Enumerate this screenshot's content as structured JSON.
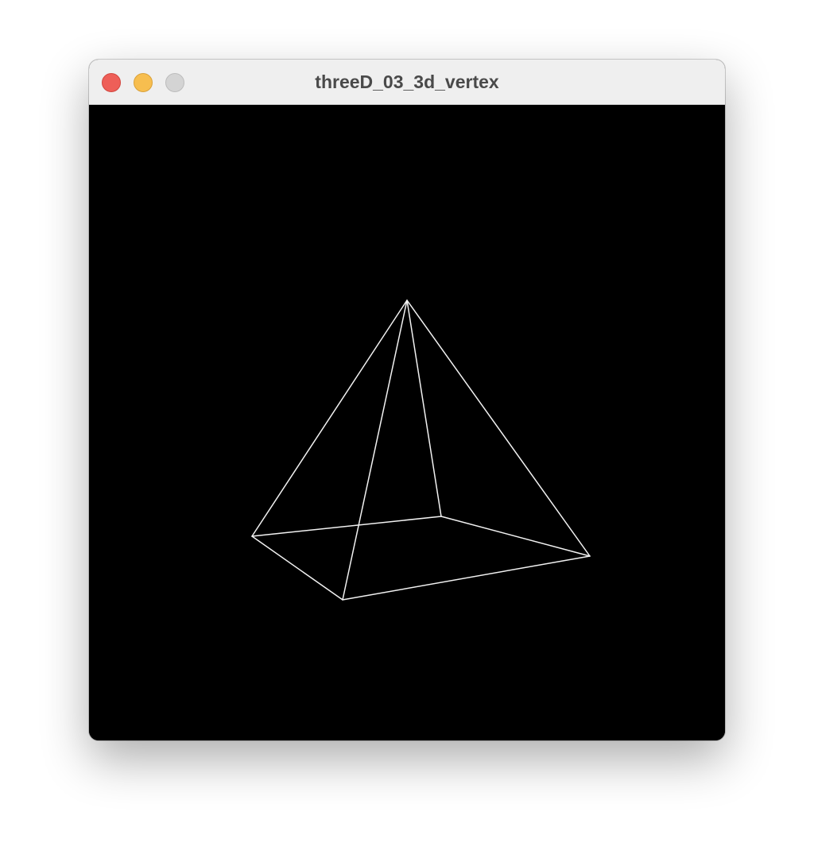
{
  "window": {
    "title": "threeD_03_3d_vertex",
    "controls": [
      {
        "name": "close",
        "color": "#ee5f58"
      },
      {
        "name": "minimize",
        "color": "#f7be4f"
      },
      {
        "name": "maximize",
        "color": "#d4d4d4"
      }
    ]
  },
  "canvas": {
    "background": "#000000",
    "stroke_color": "#f2f2f2",
    "shape": "wireframe square pyramid"
  }
}
